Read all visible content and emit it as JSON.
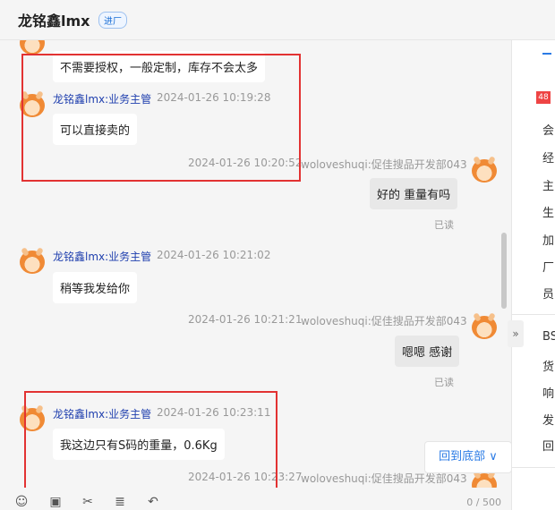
{
  "header": {
    "title": "龙铭鑫lmx",
    "badge": "进厂"
  },
  "messages": [
    {
      "text": "不需要授权，一般定制，库存不会太多"
    },
    {
      "name": "龙铭鑫lmx:业务主管",
      "time": "2024-01-26 10:19:28",
      "text": "可以直接卖的"
    },
    {
      "time": "2024-01-26 10:20:52",
      "sender": "woloveshuqi:促佳搜品开发部043",
      "text": "好的 重量有吗",
      "status": "已读"
    },
    {
      "name": "龙铭鑫lmx:业务主管",
      "time": "2024-01-26 10:21:02",
      "text": "稍等我发给你"
    },
    {
      "time": "2024-01-26 10:21:21",
      "sender": "woloveshuqi:促佳搜品开发部043",
      "text": "嗯嗯 感谢",
      "status": "已读"
    },
    {
      "name": "龙铭鑫lmx:业务主管",
      "time": "2024-01-26 10:23:11",
      "text": "我这边只有S码的重量，0.6Kg"
    },
    {
      "time": "2024-01-26 10:23:27",
      "sender": "woloveshuqi:促佳搜品开发部043"
    }
  ],
  "back_to_bottom": "回到底部 ∨",
  "toolbar": {
    "icons": [
      "emoji-icon",
      "image-icon",
      "scissors-icon",
      "document-icon",
      "recall-icon"
    ],
    "counter": "0 / 500"
  },
  "right_panel": {
    "tag": "48",
    "items": [
      "会",
      "经",
      "主",
      "生",
      "加",
      "厂",
      "员"
    ],
    "items2": [
      "BS",
      "货",
      "响",
      "发",
      "回"
    ]
  },
  "colors": {
    "highlight": "#e23232",
    "accent": "#2b7be5",
    "name": "#1f3fae"
  }
}
